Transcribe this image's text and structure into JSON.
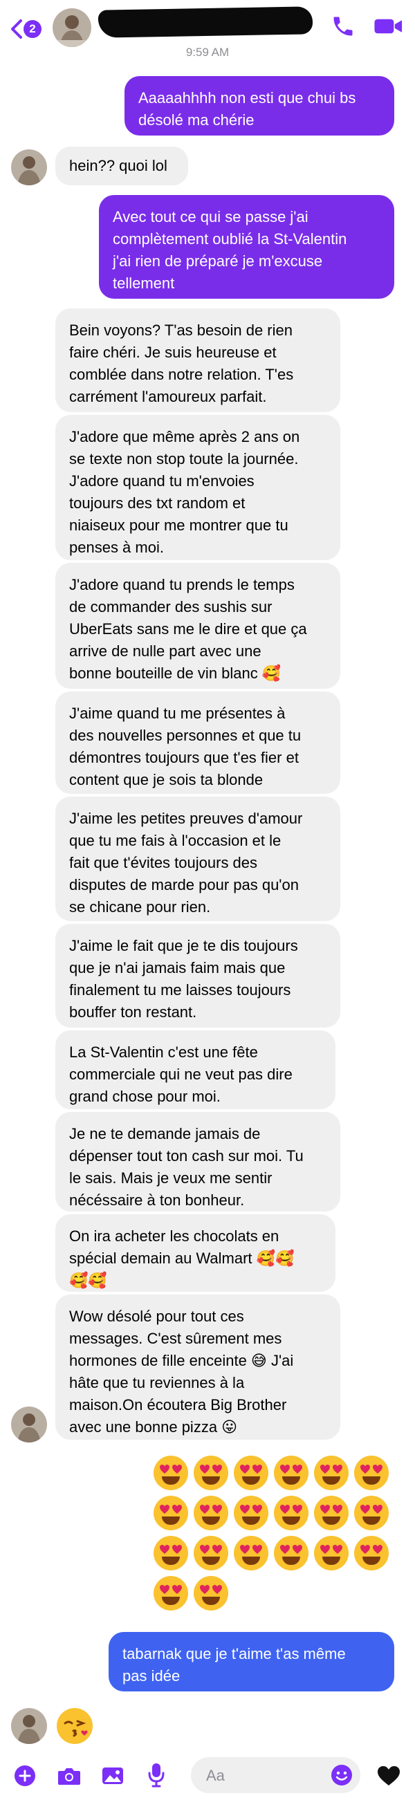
{
  "header": {
    "unread_badge": "2",
    "timestamp": "9:59 AM",
    "icons": [
      "chevron-left-icon",
      "phone-icon",
      "video-camera-icon"
    ]
  },
  "messages": [
    {
      "dir": "out",
      "text": "Aaaaahhhh non esti que chui bs\ndésolé ma chérie"
    },
    {
      "dir": "in",
      "text": "hein?? quoi lol"
    },
    {
      "dir": "out",
      "text": "Avec tout ce qui se passe j'ai\ncomplètement oublié la St-Valentin\nj'ai rien de préparé je m'excuse\ntellement"
    },
    {
      "dir": "in",
      "text": "Bein voyons? T'as besoin de rien\nfaire chéri. Je suis heureuse et\ncomblée dans notre relation. T'es\ncarrément l'amoureux parfait."
    },
    {
      "dir": "in",
      "text": "J'adore que même après 2 ans on\nse texte non stop toute la journée.\nJ'adore quand tu m'envoies\ntoujours des txt random et\nniaiseux pour me montrer que tu\npenses à moi."
    },
    {
      "dir": "in",
      "text": "J'adore quand tu prends le temps\nde commander des sushis sur\nUberEats sans me le dire et que ça\narrive de nulle part avec une\nbonne bouteille de vin blanc 🥰"
    },
    {
      "dir": "in",
      "text": "J'aime quand tu me présentes à\ndes nouvelles personnes et que tu\ndémontres toujours que t'es fier et\ncontent que je sois ta blonde"
    },
    {
      "dir": "in",
      "text": "J'aime les petites preuves d'amour\nque tu me fais à l'occasion et le\nfait que t'évites toujours des\ndisputes de marde pour pas qu'on\nse chicane pour rien."
    },
    {
      "dir": "in",
      "text": "J'aime le fait que je te dis toujours\nque je n'ai jamais faim mais que\nfinalement tu me laisses toujours\nbouffer ton restant."
    },
    {
      "dir": "in",
      "text": "La St-Valentin c'est une fête\ncommerciale qui ne veut pas dire\ngrand chose pour moi."
    },
    {
      "dir": "in",
      "text": "Je ne te demande jamais de\ndépenser tout ton cash sur moi. Tu\nle sais. Mais je veux me sentir\nnécéssaire à ton bonheur."
    },
    {
      "dir": "in",
      "text": "On ira acheter les chocolats en\nspécial demain au Walmart 🥰🥰\n🥰🥰"
    },
    {
      "dir": "in",
      "text": "Wow désolé pour tout ces\nmessages. C'est sûrement mes\nhormones de fille enceinte 😅 J'ai\nhâte que tu reviennes à la\nmaison.On écoutera Big Brother\navec une bonne pizza 😛"
    },
    {
      "dir": "out",
      "text": "tabarnak que je t'aime t'as même\npas idée"
    }
  ],
  "emoji_message": {
    "emoji": "heart-eyes-face",
    "count": 20
  },
  "kiss_message": {
    "emoji": "face-blowing-kiss"
  },
  "input": {
    "placeholder": "Aa",
    "icons": [
      "plus-icon",
      "camera-icon",
      "gallery-icon",
      "microphone-icon",
      "emoji-icon",
      "heart-icon"
    ]
  },
  "colors": {
    "accent": "#7b2ff7",
    "outgoing_bubble": "#7a2de9",
    "outgoing_bubble_last": "#3f63f0",
    "incoming_bubble": "#efeff0",
    "emoji_yellow": "#f9c22e",
    "heart_red": "#e0245e"
  }
}
